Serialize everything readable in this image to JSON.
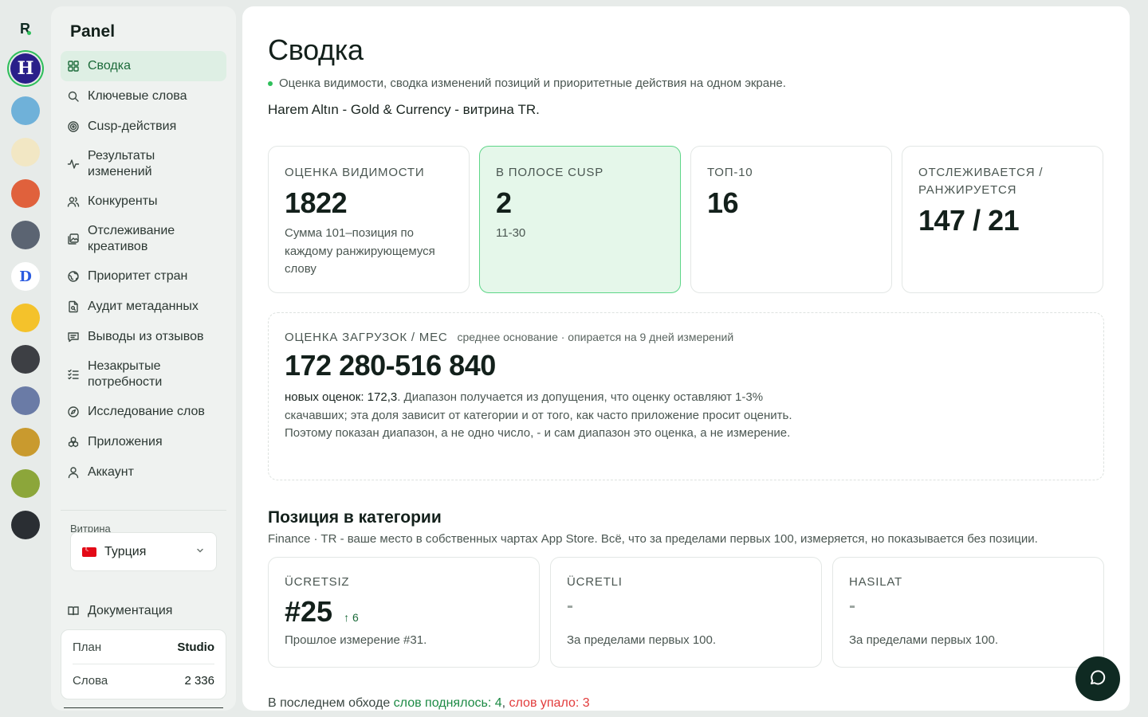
{
  "brand": {
    "logo_letter": "R"
  },
  "rail": {
    "apps": [
      {
        "letter": "H",
        "bg": "#2a1f8a",
        "fg": "#ffffff",
        "active": true
      },
      {
        "letter": "",
        "bg": "#6fb1d9",
        "active": false
      },
      {
        "letter": "",
        "bg": "#f2e7c4",
        "active": false
      },
      {
        "letter": "",
        "bg": "#e0613c",
        "active": false
      },
      {
        "letter": "",
        "bg": "#5b6472",
        "active": false
      },
      {
        "letter": "D",
        "bg": "#ffffff",
        "fg": "#2b5be0",
        "active": false
      },
      {
        "letter": "",
        "bg": "#f4c22b",
        "active": false
      },
      {
        "letter": "",
        "bg": "#3d3f44",
        "active": false
      },
      {
        "letter": "",
        "bg": "#6a7ba6",
        "active": false
      },
      {
        "letter": "",
        "bg": "#c99a2e",
        "active": false
      },
      {
        "letter": "",
        "bg": "#8ca63a",
        "active": false
      },
      {
        "letter": "",
        "bg": "#2a2e33",
        "active": false
      }
    ]
  },
  "sidebar": {
    "title": "Panel",
    "nav": [
      {
        "label": "Сводка",
        "icon": "dashboard-grid-icon",
        "active": true
      },
      {
        "label": "Ключевые слова",
        "icon": "search-icon"
      },
      {
        "label": "Cusp-действия",
        "icon": "target-icon"
      },
      {
        "label": "Результаты изменений",
        "icon": "activity-icon"
      },
      {
        "label": "Конкуренты",
        "icon": "users-icon"
      },
      {
        "label": "Отслеживание креативов",
        "icon": "images-icon"
      },
      {
        "label": "Приоритет стран",
        "icon": "globe-icon"
      },
      {
        "label": "Аудит метаданных",
        "icon": "file-search-icon"
      },
      {
        "label": "Выводы из отзывов",
        "icon": "message-icon"
      },
      {
        "label": "Незакрытые потребности",
        "icon": "list-check-icon"
      },
      {
        "label": "Исследование слов",
        "icon": "compass-icon"
      },
      {
        "label": "Приложения",
        "icon": "boxes-icon"
      },
      {
        "label": "Аккаунт",
        "icon": "user-icon"
      }
    ],
    "storefront_label": "Витрина",
    "storefront_value": "Турция",
    "docs_label": "Документация",
    "plan": {
      "plan_label": "План",
      "plan_value": "Studio",
      "words_label": "Слова",
      "words_value": "2 336"
    }
  },
  "main": {
    "title": "Сводка",
    "subtitle": "Оценка видимости, сводка изменений позиций и приоритетные действия на одном экране.",
    "app_name": "Harem Altın - Gold & Currency - витрина TR.",
    "stats": [
      {
        "label": "ОЦЕНКА ВИДИМОСТИ",
        "value": "1822",
        "note": "Сумма 101–позиция по каждому ранжирующемуся слову"
      },
      {
        "label": "В ПОЛОСЕ CUSP",
        "value": "2",
        "note": "11-30"
      },
      {
        "label": "ТОП-10",
        "value": "16",
        "note": ""
      },
      {
        "label": "ОТСЛЕЖИВАЕТСЯ / РАНЖИРУЕТСЯ",
        "value": "147 / 21",
        "note": ""
      }
    ],
    "downloads": {
      "label": "ОЦЕНКА ЗАГРУЗОК / МЕС",
      "hint": "среднее основание · опирается на 9 дней измерений",
      "value": "172 280-516 840",
      "text_strong": "новых оценок: 172,3",
      "text_rest": ". Диапазон получается из допущения, что оценку оставляют 1-3% скачавших; эта доля зависит от категории и от того, как часто приложение просит оценить. Поэтому показан диапазон, а не одно число, - и сам диапазон это оценка, а не измерение."
    },
    "category": {
      "title": "Позиция в категории",
      "subtitle": "Finance · TR - ваше место в собственных чартах App Store. Всё, что за пределами первых 100, измеряется, но показывается без позиции.",
      "cards": [
        {
          "label": "ÜCRETSIZ",
          "value": "#25",
          "delta": "↑ 6",
          "note": "Прошлое измерение #31."
        },
        {
          "label": "ÜCRETLI",
          "value": "-",
          "delta": "",
          "note": "За пределами первых 100."
        },
        {
          "label": "HASILAT",
          "value": "-",
          "delta": "",
          "note": "За пределами первых 100."
        }
      ]
    },
    "crawl": {
      "prefix": "В последнем обходе",
      "up": "слов поднялось: 4",
      "sep": ",",
      "down": "слов упало: 3"
    }
  }
}
